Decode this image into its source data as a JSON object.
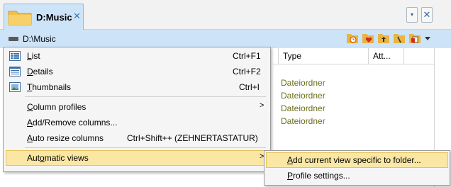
{
  "tab": {
    "title": "D:Music",
    "close_glyph": "✕",
    "icon": "folder-icon"
  },
  "tabstrip": {
    "menu_glyph": "▾",
    "close_glyph": "✕"
  },
  "address": {
    "path": "D:\\Music",
    "drive_icon": "drive-icon"
  },
  "toolbar_icons": [
    "history-folder-icon",
    "favorite-folder-icon",
    "up-folder-icon",
    "root-folder-icon",
    "copy-path-icon",
    "dropdown-arrow-icon"
  ],
  "columns": {
    "type": "Type",
    "attributes": "Att..."
  },
  "rows": [
    {
      "type": "Dateiordner"
    },
    {
      "type": "Dateiordner"
    },
    {
      "type": "Dateiordner"
    },
    {
      "type": "Dateiordner"
    }
  ],
  "menu": {
    "view_items": [
      {
        "label": "List",
        "mnemonic": "L",
        "rest": "ist",
        "shortcut": "Ctrl+F1",
        "icon": "list-view-icon"
      },
      {
        "label": "Details",
        "mnemonic": "D",
        "rest": "etails",
        "shortcut": "Ctrl+F2",
        "icon": "details-view-icon"
      },
      {
        "label": "Thumbnails",
        "mnemonic": "T",
        "rest": "humbnails",
        "shortcut": "Ctrl+I",
        "icon": "thumbnails-view-icon"
      }
    ],
    "column_profiles": {
      "pre": "",
      "mn": "C",
      "post": "olumn profiles",
      "arrow": ">"
    },
    "add_remove": {
      "pre": "",
      "mn": "A",
      "post": "dd/Remove columns..."
    },
    "auto_resize": {
      "pre": "",
      "mn": "A",
      "post": "uto resize columns",
      "shortcut": "Ctrl+Shift++ (ZEHNERTASTATUR)"
    },
    "automatic_views": {
      "pre": "Aut",
      "mn": "o",
      "post": "matic views",
      "arrow": ">"
    }
  },
  "submenu": {
    "add_current": {
      "pre": "",
      "mn": "A",
      "post": "dd current view specific to folder..."
    },
    "profile_settings": {
      "pre": "",
      "mn": "P",
      "post": "rofile settings..."
    }
  },
  "colors": {
    "accent": "#cde3f7",
    "highlight": "#fbe7a4",
    "type_text": "#6b6d1a"
  }
}
